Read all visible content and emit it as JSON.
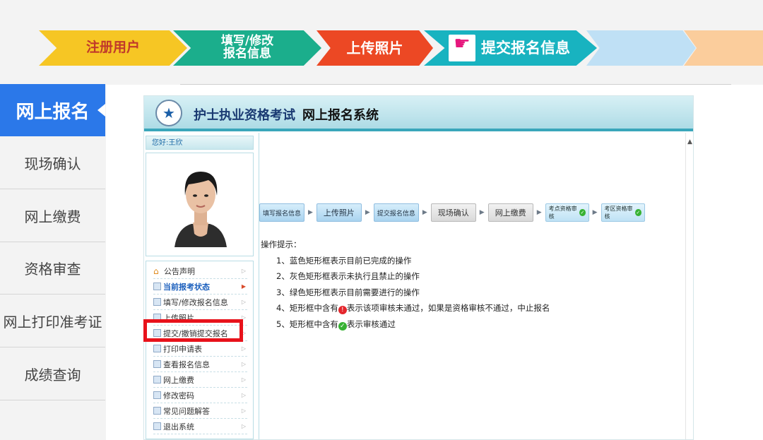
{
  "steps": [
    {
      "label": "注册用户"
    },
    {
      "label_line1": "填写/修改",
      "label_line2": "报名信息"
    },
    {
      "label": "上传照片"
    },
    {
      "label": "提交报名信息",
      "icon": "pointing-hand-icon"
    },
    {
      "label": ""
    },
    {
      "label": ""
    }
  ],
  "nav": {
    "active": "网上报名",
    "items": [
      "现场确认",
      "网上缴费",
      "资格审查",
      "网上打印准考证",
      "成绩查询"
    ]
  },
  "system": {
    "title_part1": "护士执业资格考试",
    "title_part2": "网上报名系统",
    "welcome": "您好:王欣",
    "menu": [
      {
        "label": "公告声明",
        "icon": "house-icon"
      },
      {
        "label": "当前报考状态",
        "icon": "document-icon",
        "current": true
      },
      {
        "label": "填写/修改报名信息",
        "icon": "document-icon"
      },
      {
        "label": "上传照片",
        "icon": "document-icon"
      },
      {
        "label": "提交/撤销提交报名",
        "icon": "document-icon"
      },
      {
        "label": "打印申请表",
        "icon": "document-icon"
      },
      {
        "label": "查看报名信息",
        "icon": "document-icon"
      },
      {
        "label": "网上缴费",
        "icon": "document-icon"
      },
      {
        "label": "修改密码",
        "icon": "document-icon"
      },
      {
        "label": "常见问题解答",
        "icon": "document-icon"
      },
      {
        "label": "退出系统",
        "icon": "document-icon"
      }
    ],
    "flow": [
      {
        "label": "填写报名信息",
        "style": "blue"
      },
      {
        "label": "上传照片",
        "style": "blue"
      },
      {
        "label": "提交报名信息",
        "style": "blue"
      },
      {
        "label": "现场确认",
        "style": "gray"
      },
      {
        "label": "网上缴费",
        "style": "gray"
      },
      {
        "label": "考点资格审核",
        "style": "green",
        "check": true
      },
      {
        "label": "考区资格审核",
        "style": "green",
        "check": true
      }
    ],
    "tips_title": "操作提示：",
    "tips": {
      "t1": "1、蓝色矩形框表示目前已完成的操作",
      "t2": "2、灰色矩形框表示未执行且禁止的操作",
      "t3": "3、绿色矩形框表示目前需要进行的操作",
      "t4_a": "4、矩形框中含有",
      "t4_b": "表示该项审核未通过，如果是资格审核不通过，中止报名",
      "t5_a": "5、矩形框中含有",
      "t5_b": "表示审核通过"
    }
  },
  "colors": {
    "nav_active": "#2b78e9",
    "highlight_box": "#e8121b"
  }
}
